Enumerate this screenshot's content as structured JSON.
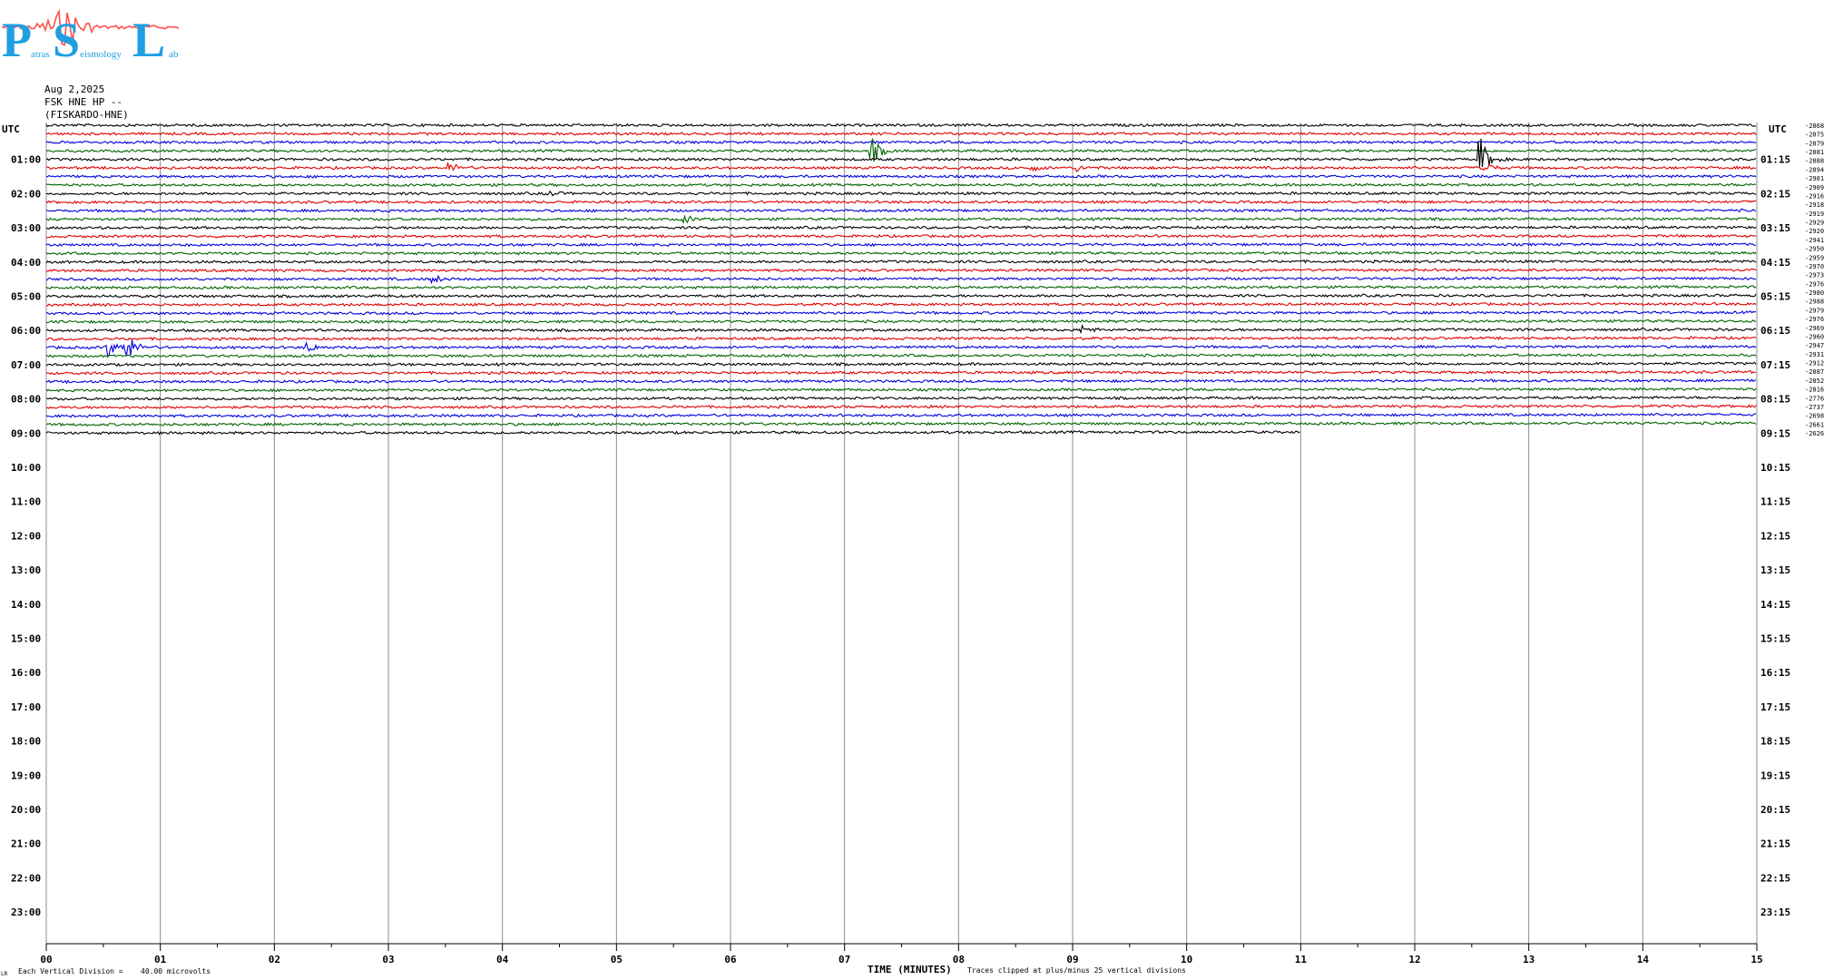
{
  "logo": {
    "letters": [
      "P",
      "S",
      "L"
    ],
    "words": [
      "atras",
      "eismology",
      "ab"
    ],
    "color": "#1f9fe0",
    "wave_color": "#ff5050"
  },
  "header": {
    "date": "Aug 2,2025",
    "station": "FSK HNE HP --",
    "site": "(FISKARDO-HNE)"
  },
  "axis": {
    "left_title": "UTC",
    "right_title": "UTC",
    "left_hours": [
      "01:00",
      "02:00",
      "03:00",
      "04:00",
      "05:00",
      "06:00",
      "07:00",
      "08:00",
      "09:00",
      "10:00",
      "11:00",
      "12:00",
      "13:00",
      "14:00",
      "15:00",
      "16:00",
      "17:00",
      "18:00",
      "19:00",
      "20:00",
      "21:00",
      "22:00",
      "23:00"
    ],
    "right_hours": [
      "01:15",
      "02:15",
      "03:15",
      "04:15",
      "05:15",
      "06:15",
      "07:15",
      "08:15",
      "09:15",
      "10:15",
      "11:15",
      "12:15",
      "13:15",
      "14:15",
      "15:15",
      "16:15",
      "17:15",
      "18:15",
      "19:15",
      "20:15",
      "21:15",
      "22:15",
      "23:15"
    ],
    "minute_ticks": [
      "00",
      "01",
      "02",
      "03",
      "04",
      "05",
      "06",
      "07",
      "08",
      "09",
      "10",
      "11",
      "12",
      "13",
      "14",
      "15"
    ],
    "xlabel": "TIME (MINUTES)"
  },
  "footer": {
    "marker": "LR",
    "division_label": "Each Vertical Division =",
    "division_value": "40.00 microvolts",
    "clip_note": "Traces clipped at plus/minus 25 vertical divisions"
  },
  "chart_data": {
    "type": "line",
    "title": "",
    "xlabel": "TIME (MINUTES)",
    "ylabel": "UTC",
    "xlim": [
      0,
      15
    ],
    "rows_per_hour": 4,
    "row_colors": [
      "#000000",
      "#e00000",
      "#0000e0",
      "#006400"
    ],
    "grid": true,
    "trace_count": 37,
    "last_trace_end_minute": 11,
    "trace_offsets": [
      "-2868",
      "-2875",
      "-2879",
      "-2881",
      "-2888",
      "-2894",
      "-2901",
      "-2909",
      "-2916",
      "-2918",
      "-2919",
      "-2929",
      "-2920",
      "-2941",
      "-2950",
      "-2959",
      "-2970",
      "-2973",
      "-2976",
      "-2980",
      "-2988",
      "-2979",
      "-2976",
      "-2969",
      "-2960",
      "-2947",
      "-2931",
      "-2912",
      "-2887",
      "-2852",
      "-2816",
      "-2776",
      "-2737",
      "-2698",
      "-2661",
      "-2626"
    ],
    "events": [
      {
        "hour": 0,
        "quarter": 3,
        "minute": 7.25,
        "amp": 13
      },
      {
        "hour": 1,
        "quarter": 1,
        "minute": 3.55,
        "amp": 5
      },
      {
        "hour": 1,
        "quarter": 1,
        "minute": 8.65,
        "amp": 3
      },
      {
        "hour": 1,
        "quarter": 1,
        "minute": 9.05,
        "amp": 3
      },
      {
        "hour": 1,
        "quarter": 0,
        "minute": 12.58,
        "amp": 22
      },
      {
        "hour": 1,
        "quarter": 1,
        "minute": 12.6,
        "amp": 8
      },
      {
        "hour": 2,
        "quarter": 3,
        "minute": 5.6,
        "amp": 4
      },
      {
        "hour": 4,
        "quarter": 2,
        "minute": 3.4,
        "amp": 4
      },
      {
        "hour": 6,
        "quarter": 2,
        "minute": 0.55,
        "amp": 9
      },
      {
        "hour": 6,
        "quarter": 2,
        "minute": 0.7,
        "amp": 18
      },
      {
        "hour": 6,
        "quarter": 2,
        "minute": 2.3,
        "amp": 5
      },
      {
        "hour": 6,
        "quarter": 0,
        "minute": 9.1,
        "amp": 4
      },
      {
        "hour": 2,
        "quarter": 0,
        "minute": 4.4,
        "amp": 3
      }
    ]
  }
}
